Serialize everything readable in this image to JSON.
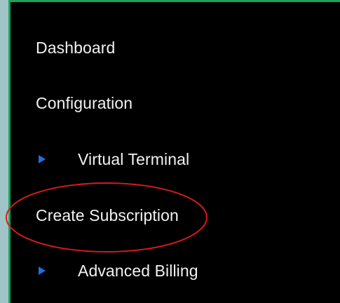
{
  "menu": {
    "items": [
      {
        "label": "Dashboard",
        "has_arrow": false
      },
      {
        "label": "Configuration",
        "has_arrow": false
      },
      {
        "label": "Virtual Terminal",
        "has_arrow": true
      },
      {
        "label": "Create Subscription",
        "has_arrow": false
      },
      {
        "label": "Advanced Billing",
        "has_arrow": true
      }
    ]
  },
  "colors": {
    "panel_background": "#000000",
    "outer_background": "#9fc3c6",
    "panel_border": "#19a45a",
    "text": "#f2f2f2",
    "arrow": "#1f6fe0",
    "highlight_ellipse": "#d61b1b"
  },
  "icons": {
    "submenu_arrow": "arrow-right-icon"
  }
}
